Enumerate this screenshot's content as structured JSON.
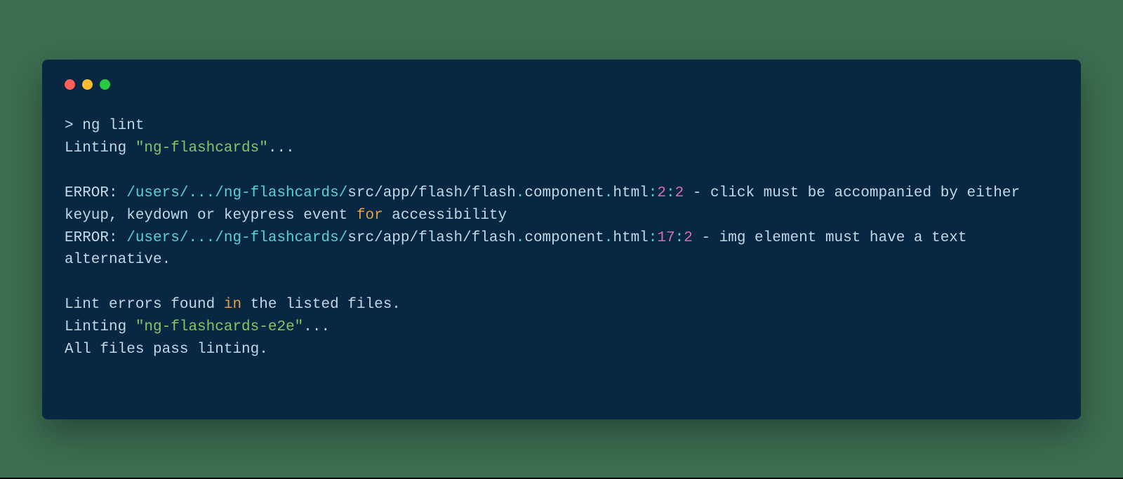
{
  "prompt": {
    "caret": "> ",
    "command": "ng lint"
  },
  "lint1": {
    "prefix": "Linting ",
    "project_quoted": "\"ng-flashcards\"",
    "suffix": "..."
  },
  "error1": {
    "label": "ERROR: ",
    "path_prefix": "/users/",
    "path_ellipsis": ".../ng-flashcards/",
    "path_tail1": "src/app/flash/flash",
    "dot1": ".",
    "component": "component",
    "dot2": ".",
    "ext": "html",
    "colon1": ":",
    "line": "2",
    "colon2": ":",
    "col": "2",
    "dash_msg1": " - click must be accompanied by either keyup, keydown or keypress event ",
    "for_kw": "for",
    "dash_msg2": " accessibility"
  },
  "error2": {
    "label": "ERROR: ",
    "path_prefix": "/users/",
    "path_ellipsis": ".../ng-flashcards/",
    "path_tail1": "src/app/flash/flash",
    "dot1": ".",
    "component": "component",
    "dot2": ".",
    "ext": "html",
    "colon1": ":",
    "line": "17",
    "colon2": ":",
    "col": "2",
    "dash_msg": " - img element must have a text alternative."
  },
  "found": {
    "pre": "Lint errors found ",
    "in_kw": "in",
    "post": " the listed files."
  },
  "lint2": {
    "prefix": "Linting ",
    "project_quoted": "\"ng-flashcards-e2e\"",
    "suffix": "..."
  },
  "pass": "All files pass linting."
}
